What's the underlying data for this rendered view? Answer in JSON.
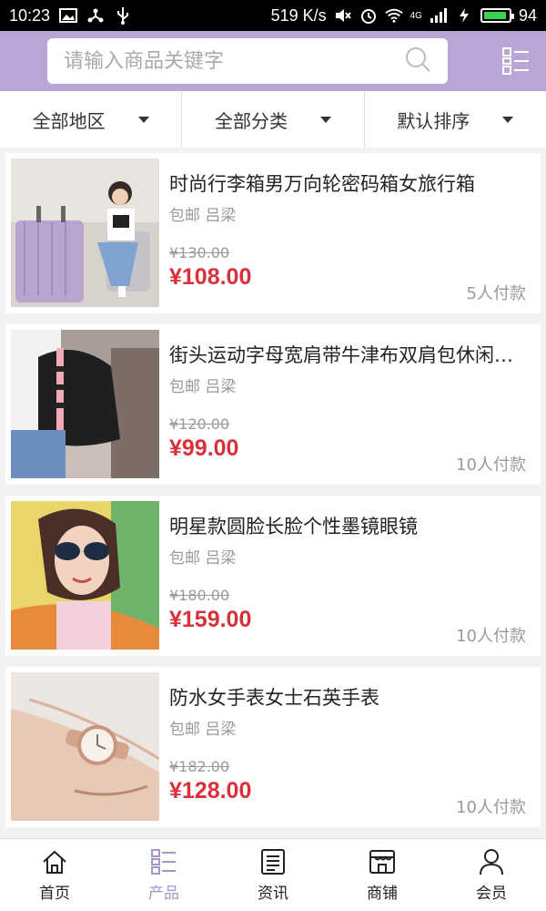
{
  "status_bar": {
    "time": "10:23",
    "net_speed": "519 K/s",
    "signal": "4G",
    "battery": "94"
  },
  "search": {
    "placeholder": "请输入商品关键字"
  },
  "filters": [
    {
      "label": "全部地区"
    },
    {
      "label": "全部分类"
    },
    {
      "label": "默认排序"
    }
  ],
  "products": [
    {
      "title": "时尚行李箱男万向轮密码箱女旅行箱",
      "shipping": "包邮 吕梁",
      "original_price": "¥130.00",
      "price": "¥108.00",
      "paid": "5人付款"
    },
    {
      "title": "街头运动字母宽肩带牛津布双肩包休闲背包",
      "shipping": "包邮 吕梁",
      "original_price": "¥120.00",
      "price": "¥99.00",
      "paid": "10人付款"
    },
    {
      "title": "明星款圆脸长脸个性墨镜眼镜",
      "shipping": "包邮 吕梁",
      "original_price": "¥180.00",
      "price": "¥159.00",
      "paid": "10人付款"
    },
    {
      "title": "防水女手表女士石英手表",
      "shipping": "包邮 吕梁",
      "original_price": "¥182.00",
      "price": "¥128.00",
      "paid": "10人付款"
    }
  ],
  "tabs": [
    {
      "label": "首页",
      "icon": "home-icon"
    },
    {
      "label": "产品",
      "icon": "product-list-icon"
    },
    {
      "label": "资讯",
      "icon": "news-icon"
    },
    {
      "label": "商铺",
      "icon": "shop-icon"
    },
    {
      "label": "会员",
      "icon": "member-icon"
    }
  ],
  "colors": {
    "accent": "#b9a6d6",
    "price": "#d9303a",
    "active_tab": "#a594c8"
  }
}
